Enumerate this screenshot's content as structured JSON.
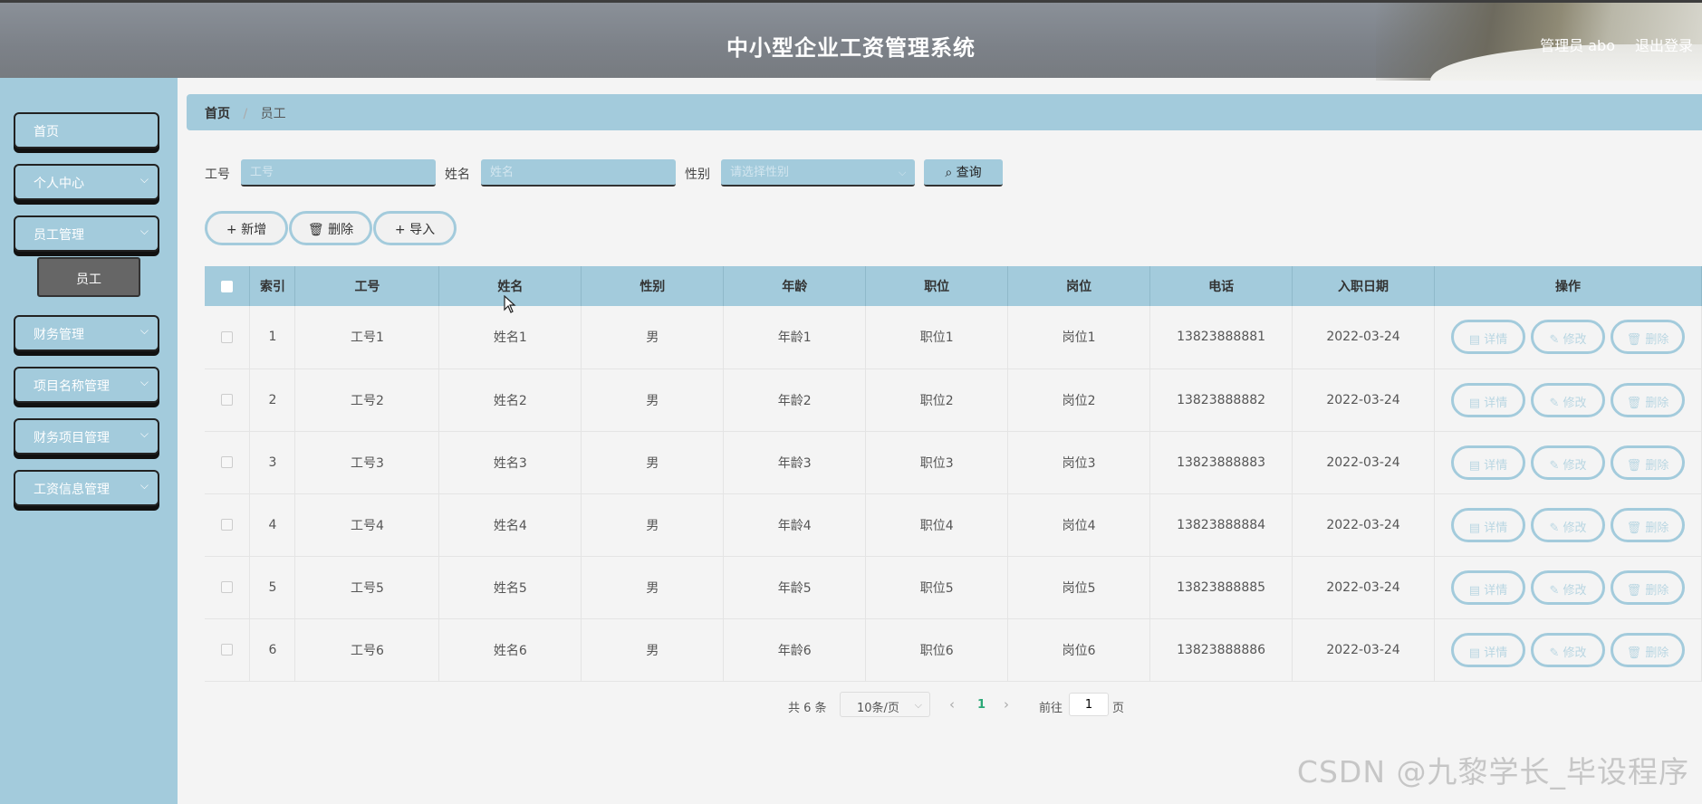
{
  "header": {
    "title": "中小型企业工资管理系统",
    "admin": "管理员 abo",
    "logout": "退出登录"
  },
  "sidebar": {
    "items": [
      {
        "label": "首页",
        "has_children": false
      },
      {
        "label": "个人中心",
        "has_children": true
      },
      {
        "label": "员工管理",
        "has_children": true
      },
      {
        "label": "财务管理",
        "has_children": true
      },
      {
        "label": "项目名称管理",
        "has_children": true
      },
      {
        "label": "财务项目管理",
        "has_children": true
      },
      {
        "label": "工资信息管理",
        "has_children": true
      }
    ],
    "submenu": {
      "label": "员工"
    }
  },
  "breadcrumb": {
    "home": "首页",
    "current": "员工"
  },
  "search": {
    "fields": [
      {
        "label": "工号",
        "placeholder": "工号"
      },
      {
        "label": "姓名",
        "placeholder": "姓名"
      },
      {
        "label": "性别",
        "placeholder": "请选择性别"
      }
    ],
    "query_button": "查询"
  },
  "actions": {
    "add": "新增",
    "delete": "删除",
    "import": "导入"
  },
  "table": {
    "columns": [
      "索引",
      "工号",
      "姓名",
      "性别",
      "年龄",
      "职位",
      "岗位",
      "电话",
      "入职日期",
      "操作"
    ],
    "rows": [
      [
        "1",
        "工号1",
        "姓名1",
        "男",
        "年龄1",
        "职位1",
        "岗位1",
        "13823888881",
        "2022-03-24"
      ],
      [
        "2",
        "工号2",
        "姓名2",
        "男",
        "年龄2",
        "职位2",
        "岗位2",
        "13823888882",
        "2022-03-24"
      ],
      [
        "3",
        "工号3",
        "姓名3",
        "男",
        "年龄3",
        "职位3",
        "岗位3",
        "13823888883",
        "2022-03-24"
      ],
      [
        "4",
        "工号4",
        "姓名4",
        "男",
        "年龄4",
        "职位4",
        "岗位4",
        "13823888884",
        "2022-03-24"
      ],
      [
        "5",
        "工号5",
        "姓名5",
        "男",
        "年龄5",
        "职位5",
        "岗位5",
        "13823888885",
        "2022-03-24"
      ],
      [
        "6",
        "工号6",
        "姓名6",
        "男",
        "年龄6",
        "职位6",
        "岗位6",
        "13823888886",
        "2022-03-24"
      ]
    ],
    "row_actions": [
      "详情",
      "修改",
      "删除"
    ]
  },
  "pagination": {
    "total": "共 6 条",
    "page_size": "10条/页",
    "current_page": "1",
    "goto_label": "前往",
    "goto_value": "1",
    "page_unit": "页"
  },
  "watermark": "CSDN @九黎学长_毕设程序",
  "colors": {
    "accent": "#a3cbdc",
    "header": "#7c8188",
    "active_page": "#2aa876"
  }
}
